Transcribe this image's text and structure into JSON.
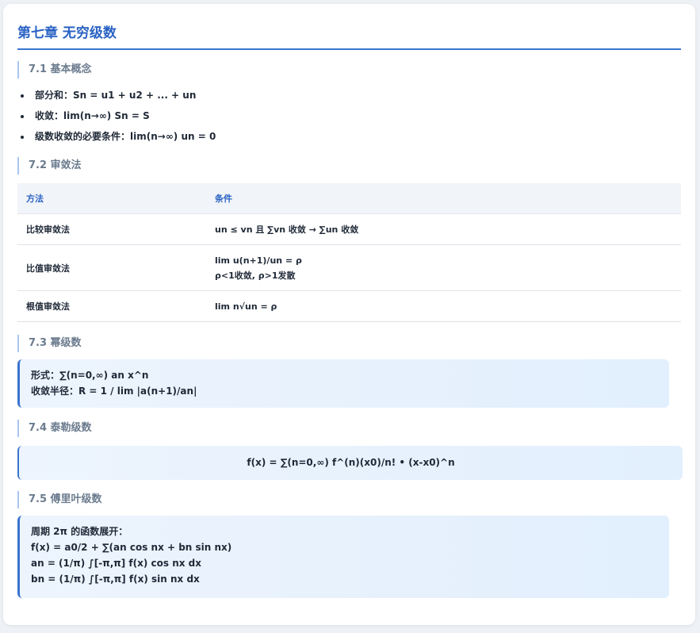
{
  "chapter_title": "第七章 无穷级数",
  "sections": {
    "s1": {
      "title": "7.1 基本概念",
      "bullets": [
        "部分和：Sn = u1 + u2 + ... + un",
        "收敛：lim(n→∞) Sn = S",
        "级数收敛的必要条件：lim(n→∞) un = 0"
      ]
    },
    "s2": {
      "title": "7.2 审敛法",
      "table": {
        "headers": [
          "方法",
          "条件"
        ],
        "rows": [
          {
            "method": "比较审敛法",
            "lines": [
              "un ≤ vn 且 ∑vn 收敛 → ∑un 收敛"
            ]
          },
          {
            "method": "比值审敛法",
            "lines": [
              "lim u(n+1)/un = ρ",
              "ρ<1收敛, ρ>1发散"
            ]
          },
          {
            "method": "根值审敛法",
            "lines": [
              "lim n√un = ρ"
            ]
          }
        ]
      }
    },
    "s3": {
      "title": "7.3 幂级数",
      "lines": [
        "形式：∑(n=0,∞) an x^n",
        "收敛半径：R = 1 / lim |a(n+1)/an|"
      ]
    },
    "s4": {
      "title": "7.4 泰勒级数",
      "formula": "f(x) = ∑(n=0,∞) f^(n)(x0)/n! • (x-x0)^n"
    },
    "s5": {
      "title": "7.5 傅里叶级数",
      "lines": [
        "周期 2π 的函数展开：",
        "f(x) = a0/2 + ∑(an cos nx + bn sin nx)",
        "an = (1/π) ∫[-π,π] f(x) cos nx dx",
        "bn = (1/π) ∫[-π,π] f(x) sin nx dx"
      ]
    }
  },
  "colors": {
    "accent": "#2a62c4",
    "section_title": "#6b7b8e",
    "box_bg": "#e8f1fd"
  }
}
